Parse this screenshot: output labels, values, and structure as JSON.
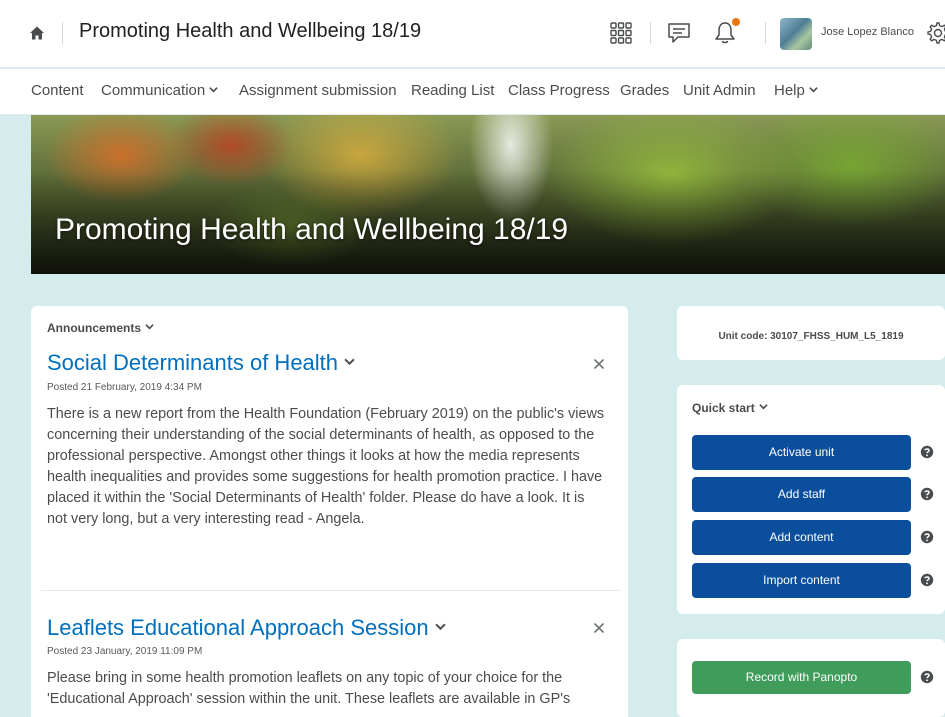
{
  "topbar": {
    "course_title": "Promoting Health and Wellbeing 18/19",
    "user_name": "Jose Lopez Blanco",
    "notification_color": "#e87511"
  },
  "nav": {
    "items": [
      "Content",
      "Communication",
      "Assignment submission",
      "Reading List",
      "Class Progress",
      "Grades",
      "Unit Admin",
      "Help"
    ]
  },
  "banner": {
    "title": "Promoting Health and Wellbeing 18/19"
  },
  "announcements": {
    "header": "Announcements",
    "items": [
      {
        "title": "Social Determinants of Health",
        "date": "Posted 21 February, 2019 4:34 PM",
        "body": "There is a new report from the Health Foundation (February 2019) on the public's views concerning their understanding of the social determinants of health, as opposed to the professional perspective.  Amongst other things it looks at how the media represents health inequalities and provides some suggestions for health promotion practice.  I have placed it within the 'Social Determinants of Health' folder.  Please do have a look.  It is not very long, but a very interesting read  - Angela."
      },
      {
        "title": "Leaflets Educational Approach Session",
        "date": "Posted 23 January, 2019 11:09 PM",
        "body": "Please bring in some health promotion leaflets on any topic of your choice for the 'Educational Approach' session within the unit.  These leaflets are available in GP's"
      }
    ]
  },
  "side": {
    "unit_code": "Unit code: 30107_FHSS_HUM_L5_1819",
    "quick_start": {
      "header": "Quick start",
      "buttons": [
        "Activate unit",
        "Add staff",
        "Add content",
        "Import content"
      ],
      "button_color": "#0b4f9c"
    },
    "panopto": {
      "label": "Record with Panopto",
      "color": "#3f9c5a"
    }
  }
}
